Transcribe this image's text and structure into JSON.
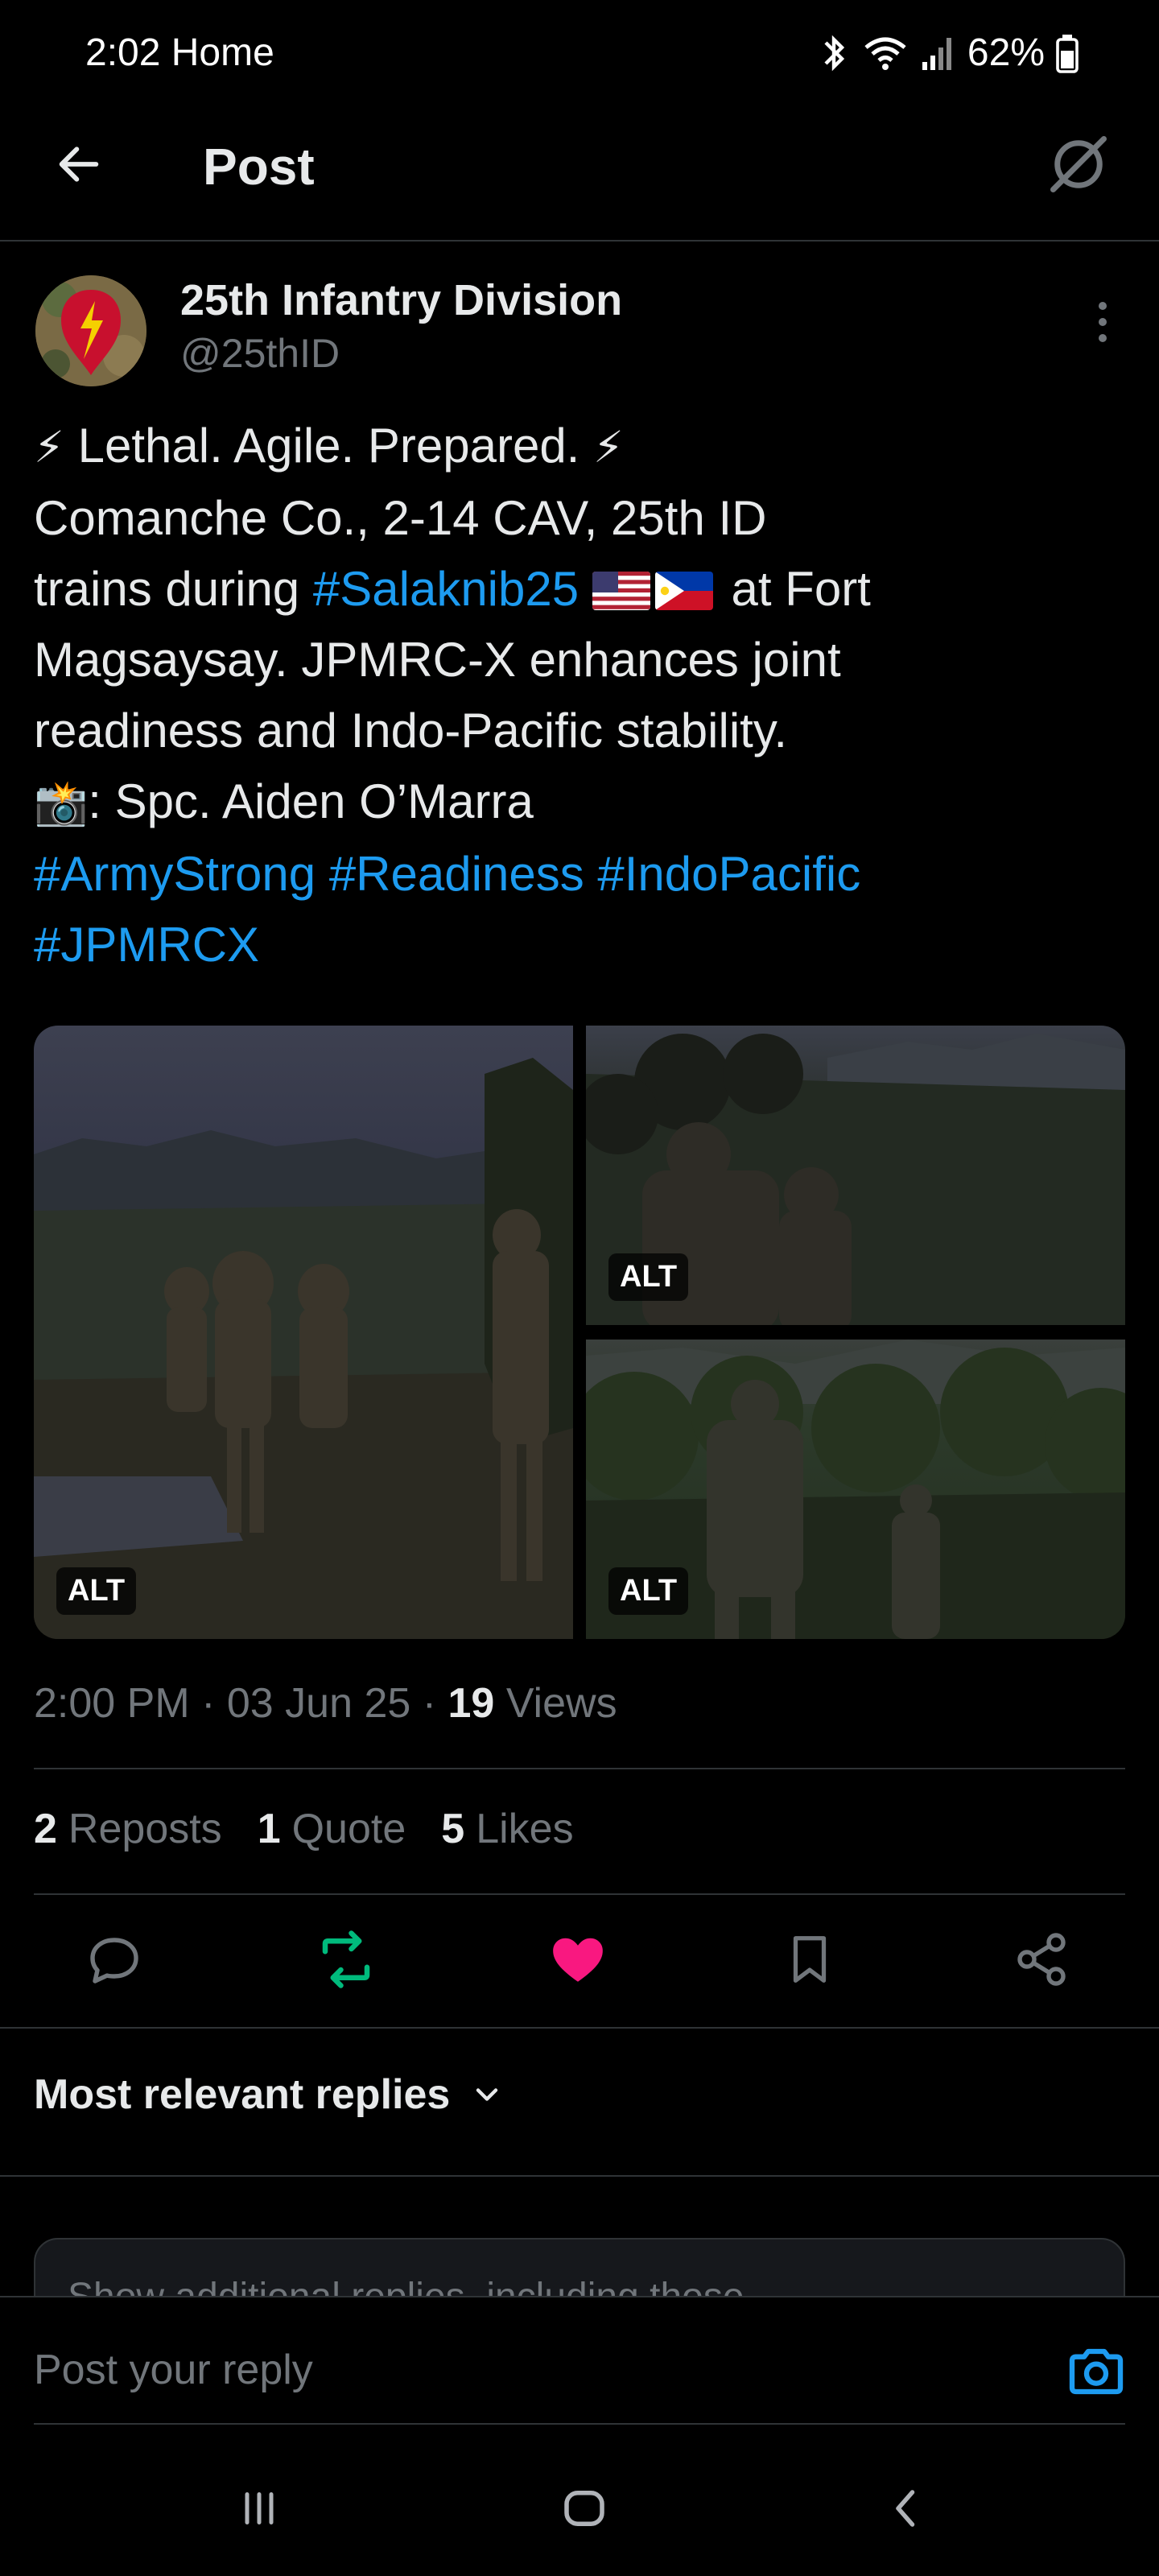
{
  "status_bar": {
    "time": "2:02",
    "label": "Home",
    "battery": "62%"
  },
  "header": {
    "title": "Post"
  },
  "author": {
    "name": "25th Infantry Division",
    "handle": "@25thID"
  },
  "post": {
    "line1_text": "Lethal. Agile. Prepared.",
    "line2_text": "Comanche Co., 2-14 CAV, 25th ID",
    "line3_prefix": "trains during ",
    "line3_hashtag": "#Salaknib25",
    "line3_suffix": " at Fort",
    "line4_text": "Magsaysay. JPMRC-X enhances joint",
    "line5_text": "readiness and Indo-Pacific stability.",
    "line6_text": ": Spc. Aiden O’Marra",
    "hashtags": [
      "#ArmyStrong",
      "#Readiness",
      "#IndoPacific",
      "#JPMRCX"
    ]
  },
  "media": {
    "alt_label": "ALT"
  },
  "meta": {
    "time": "2:00 PM",
    "separator": " · ",
    "date": "03 Jun 25",
    "views_count": "19",
    "views_label": "Views"
  },
  "stats": {
    "reposts_count": "2",
    "reposts_label": "Reposts",
    "quotes_count": "1",
    "quotes_label": "Quote",
    "likes_count": "5",
    "likes_label": "Likes"
  },
  "replies": {
    "sort_label": "Most relevant replies",
    "show_more_text": "Show additional replies, including those"
  },
  "reply_bar": {
    "placeholder": "Post your reply"
  },
  "colors": {
    "accent": "#1d9bf0",
    "repost": "#00ba7c",
    "like": "#f91880"
  }
}
